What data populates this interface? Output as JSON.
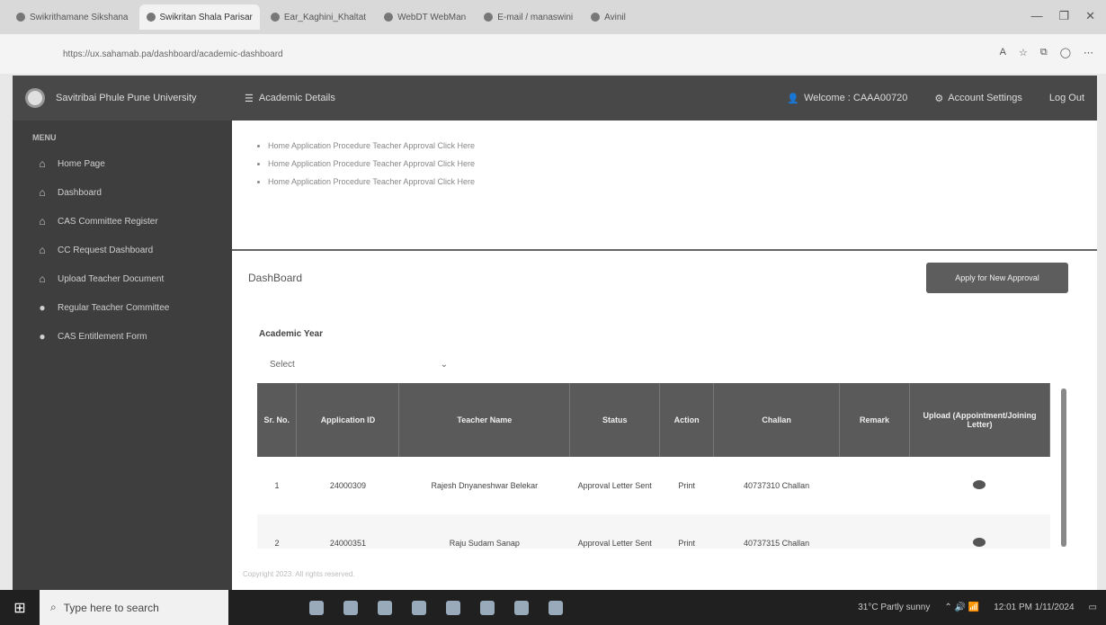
{
  "browser": {
    "tabs": [
      "Swikrithamane Sikshana",
      "Swikritan Shala Parisar",
      "Ear_Kaghini_Khaltat",
      "WebDT WebMan",
      "E-mail / manaswini",
      "Avinil"
    ],
    "active_tab": 1,
    "url": "https://ux.sahamab.pa/dashboard/academic-dashboard",
    "window_controls": [
      "—",
      "❐",
      "✕"
    ]
  },
  "topnav": {
    "brand": "Savitribai Phule Pune University",
    "menu_toggle": "Academic Details",
    "user": "Welcome : CAAA00720",
    "account": "Account Settings",
    "logout": "Log Out"
  },
  "sidebar": {
    "heading": "MENU",
    "items": [
      {
        "label": "Home Page",
        "icon": "home-icon"
      },
      {
        "label": "Dashboard",
        "icon": "home-icon"
      },
      {
        "label": "CAS Committee Register",
        "icon": "home-icon"
      },
      {
        "label": "CC Request Dashboard",
        "icon": "home-icon"
      },
      {
        "label": "Upload Teacher Document",
        "icon": "home-icon"
      },
      {
        "label": "Regular Teacher Committee",
        "icon": "circle-icon"
      },
      {
        "label": "CAS Entitlement Form",
        "icon": "circle-icon"
      }
    ]
  },
  "notices": [
    "Home Application Procedure Teacher Approval Click Here",
    "Home Application Procedure Teacher Approval Click Here",
    "Home Application Procedure Teacher Approval Click Here"
  ],
  "dashboard": {
    "title": "DashBoard",
    "apply_button": "Apply for New Approval",
    "academic_year_label": "Academic Year",
    "academic_year_value": "Select"
  },
  "table": {
    "headers": [
      "Sr. No.",
      "Application ID",
      "Teacher Name",
      "Status",
      "Action",
      "Challan",
      "Remark",
      "Upload (Appointment/Joining Letter)"
    ],
    "rows": [
      {
        "sr": "1",
        "app_id": "24000309",
        "name": "Rajesh Dnyaneshwar Belekar",
        "status": "Approval Letter Sent",
        "action": "Print",
        "challan": "40737310 Challan",
        "remark": ""
      },
      {
        "sr": "2",
        "app_id": "24000351",
        "name": "Raju Sudam Sanap",
        "status": "Approval Letter Sent",
        "action": "Print",
        "challan": "40737315 Challan",
        "remark": ""
      }
    ]
  },
  "footer": "Copyright 2023. All rights reserved.",
  "taskbar": {
    "search_placeholder": "Type here to search",
    "weather": "31°C Partly sunny",
    "time": "12:01 PM",
    "date": "1/11/2024"
  }
}
